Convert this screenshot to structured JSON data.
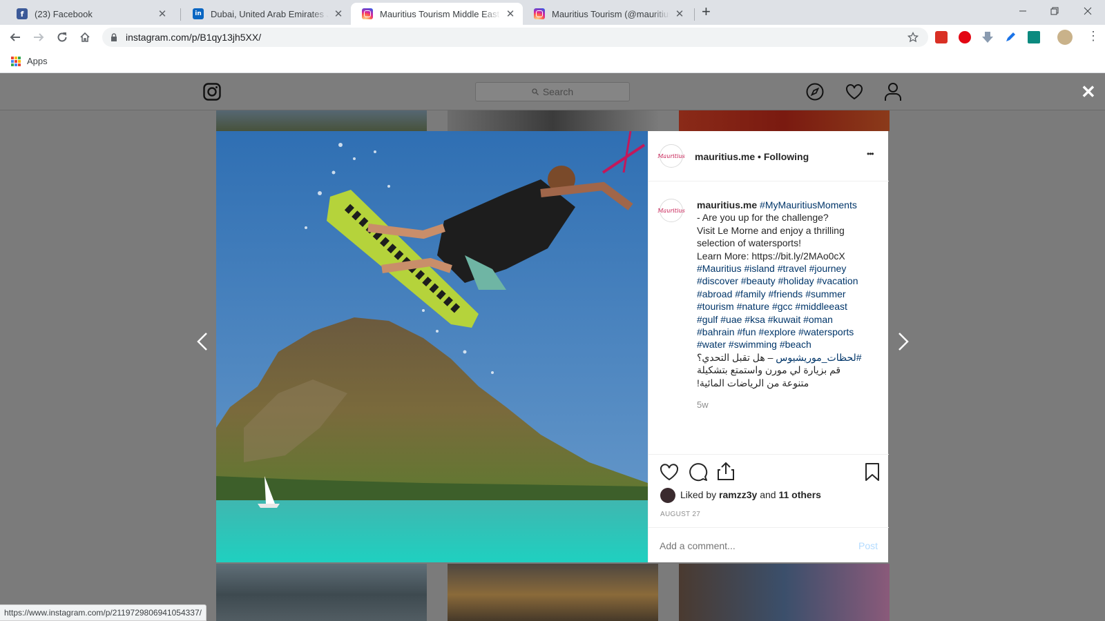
{
  "browser": {
    "tabs": [
      {
        "title": "(23) Facebook",
        "icon": "facebook-icon",
        "active": false
      },
      {
        "title": "Dubai, United Arab Emirates Jobs",
        "icon": "linkedin-icon",
        "active": false
      },
      {
        "title": "Mauritius Tourism Middle East (@",
        "icon": "instagram-icon",
        "active": true
      },
      {
        "title": "Mauritius Tourism (@mauritius.to",
        "icon": "instagram-icon",
        "active": false
      }
    ],
    "new_tab": "+",
    "url": "instagram.com/p/B1qy13jh5XX/",
    "bookmarks": {
      "apps_label": "Apps"
    },
    "status_url": "https://www.instagram.com/p/2119729806941054337/"
  },
  "instagram": {
    "search_placeholder": "Search",
    "post": {
      "username": "mauritius.me",
      "follow_state": "Following",
      "header_text": "mauritius.me • Following",
      "more": "•••",
      "caption_hashtag": "#MyMauritiusMoments",
      "caption_lines": [
        "- Are you up for the challenge?",
        "Visit Le Morne and enjoy a thrilling",
        "selection of watersports!",
        "Learn More: https://bit.ly/2MAo0cX"
      ],
      "hashtag_lines": [
        "#Mauritius #island #travel #journey",
        "#discover #beauty #holiday #vacation",
        "#abroad #family #friends #summer",
        "#tourism #nature #gcc #middleeast",
        "#gulf #uae #ksa #kuwait #oman",
        "#bahrain #fun #explore #watersports",
        "#water #swimming #beach"
      ],
      "arabic_hashtag": "#لحظات_موريشيوس",
      "arabic_lines": [
        " – هل تقبل التحدي؟",
        "قم بزيارة لي مورن واستمتع بتشكيلة",
        "متنوعة من الرياضات المائية!"
      ],
      "caption_age": "5w",
      "liked_prefix": "Liked by",
      "liked_user": "ramzz3y",
      "liked_and": "and",
      "liked_others": "11 others",
      "date": "AUGUST 27",
      "comment_placeholder": "Add a comment...",
      "post_button": "Post"
    }
  }
}
